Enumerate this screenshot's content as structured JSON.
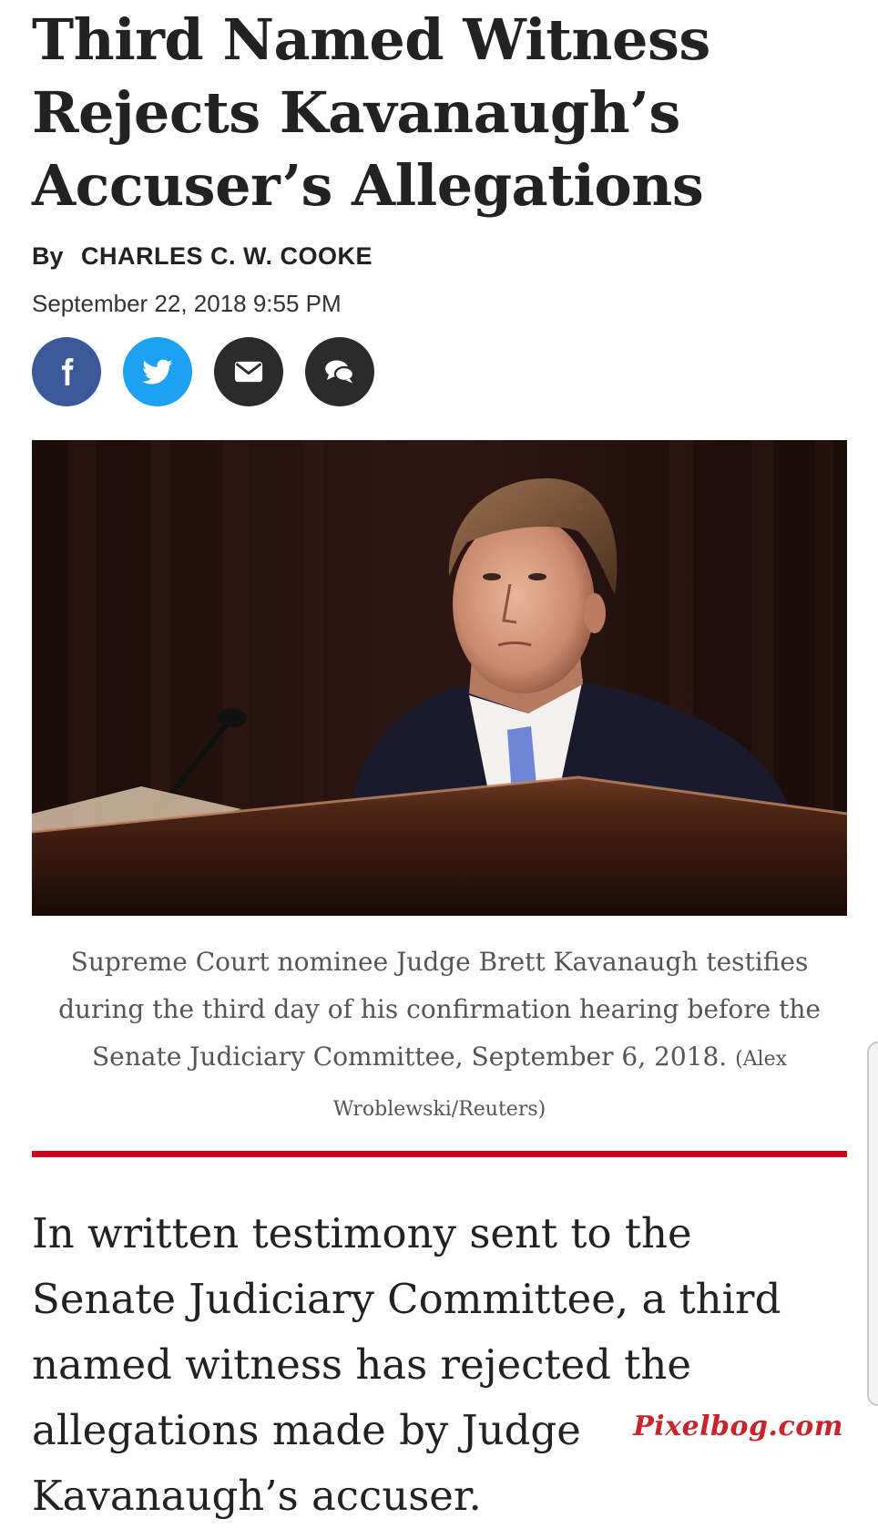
{
  "article": {
    "headline": "Third Named Witness Rejects Kavanaugh’s Accuser’s Allegations",
    "byline_prefix": "By",
    "author": "CHARLES C. W. COOKE",
    "date": "September 22, 2018 9:55 PM",
    "hero_caption": "Supreme Court nominee Judge Brett Kavanaugh testifies during the third day of his confirmation hearing before the Senate Judiciary Committee, September 6, 2018.",
    "hero_credit": "(Alex Wroblewski/Reuters)",
    "lede": "In written testimony sent to the Senate Judiciary Committee, a third named witness has rejected the allegations made by Judge Kavanaugh’s accuser."
  },
  "share": [
    {
      "icon": "facebook-icon",
      "color": "#3b5998"
    },
    {
      "icon": "twitter-icon",
      "color": "#1da1f2"
    },
    {
      "icon": "email-icon",
      "color": "#2b2b2b"
    },
    {
      "icon": "comments-icon",
      "color": "#2b2b2b"
    }
  ],
  "colors": {
    "accent_rule": "#d0021b",
    "headline": "#222222",
    "caption": "#555555"
  },
  "watermark": "Pixelbog.com"
}
